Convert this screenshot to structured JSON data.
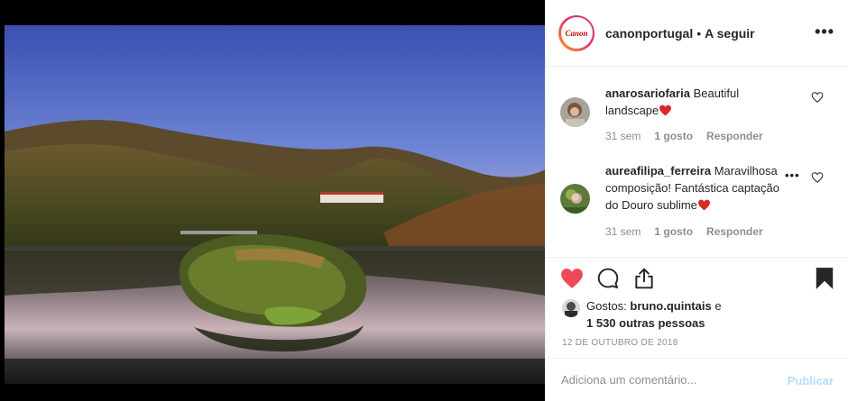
{
  "post": {
    "photo_icon": "landscape-photo"
  },
  "header": {
    "avatar_text": "Canon",
    "username": "canonportugal",
    "separator": "•",
    "follow_label": "A seguir",
    "more_label": "•••"
  },
  "comments": [
    {
      "username": "anarosariofaria",
      "text": "Beautiful landscape",
      "emoji": "heart",
      "age": "31 sem",
      "likes": "1 gosto",
      "reply_label": "Responder"
    },
    {
      "username": "aureafilipa_ferreira",
      "text": "Maravilhosa composição! Fantástica captação do Douro sublime",
      "emoji": "heart",
      "age": "31 sem",
      "likes": "1 gosto",
      "reply_label": "Responder",
      "more_label": "•••"
    }
  ],
  "actions": {
    "like_icon": "heart-filled-icon",
    "comment_icon": "comment-icon",
    "share_icon": "share-icon",
    "save_icon": "bookmark-icon"
  },
  "likes": {
    "prefix": "Gostos:",
    "user": "bruno.quintais",
    "connector": "e",
    "others": "1 530 outras pessoas"
  },
  "date": "12 DE OUTUBRO DE 2018",
  "composer": {
    "placeholder": "Adiciona um comentário...",
    "publish_label": "Publicar"
  },
  "colors": {
    "like_red": "#ed4956",
    "publish_disabled": "#b2dffc",
    "muted_text": "#8e8e8e",
    "brand_red": "#cc0000"
  }
}
